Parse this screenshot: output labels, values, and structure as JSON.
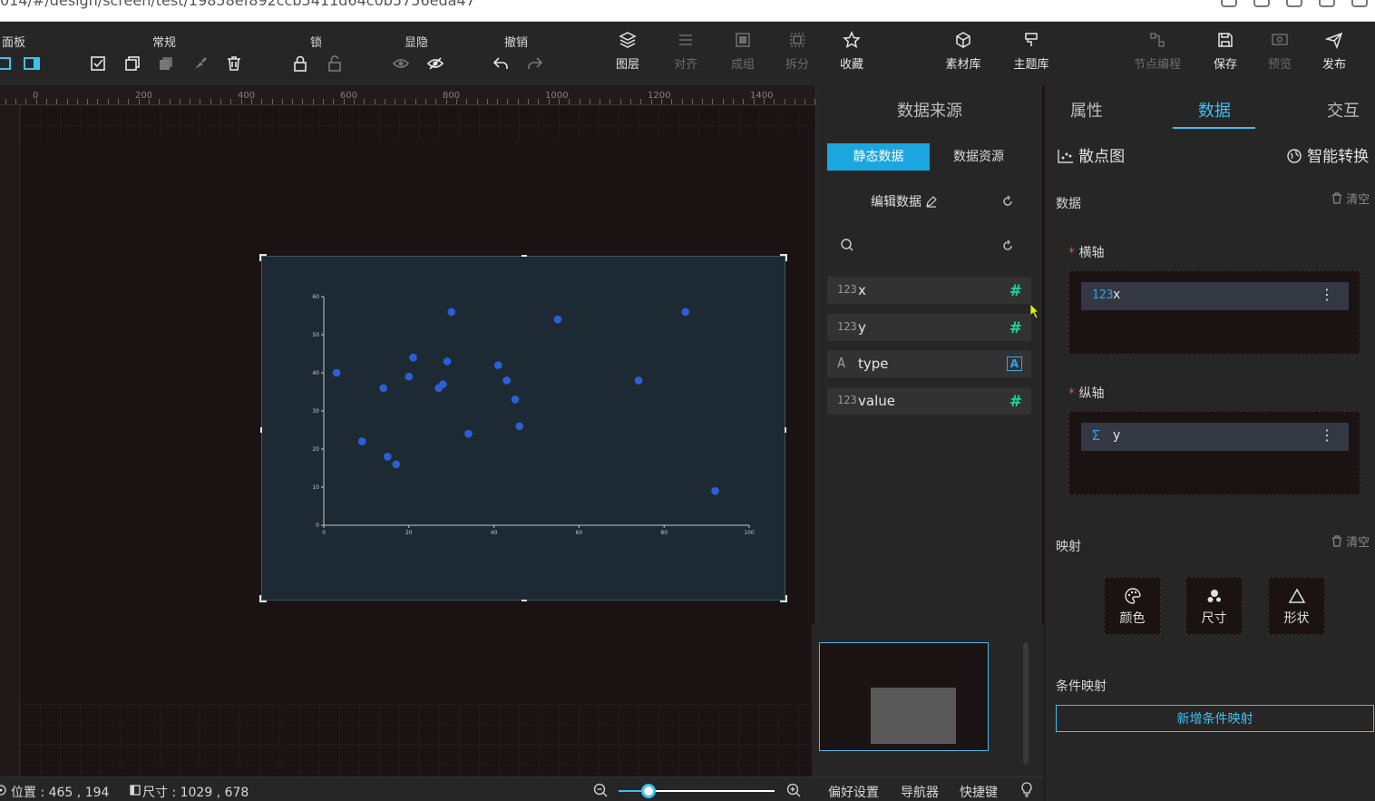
{
  "browser": {
    "url": "014/#/design/screen/test/19858ef892ccb5411d64c0b5756eda47"
  },
  "toolbar": {
    "groups": {
      "panel": "面板",
      "common": "常规",
      "lock": "锁",
      "visibility": "显隐",
      "undo": "撤销"
    },
    "buttons": {
      "layers": "图层",
      "align": "对齐",
      "group": "成组",
      "ungroup": "拆分",
      "favorite": "收藏",
      "assets": "素材库",
      "themes": "主题库",
      "node_program": "节点编程",
      "save": "保存",
      "preview": "预览",
      "publish": "发布"
    }
  },
  "ruler": {
    "labels": [
      "0",
      "200",
      "400",
      "600",
      "800",
      "1000",
      "1200",
      "1400"
    ]
  },
  "datasource": {
    "title": "数据来源",
    "tab_static": "静态数据",
    "tab_resource": "数据资源",
    "edit_label": "编辑数据",
    "fields": [
      {
        "type": "123",
        "name": "x",
        "badge": "#"
      },
      {
        "type": "123",
        "name": "y",
        "badge": "#"
      },
      {
        "type": "A",
        "name": "type",
        "badge": "A"
      },
      {
        "type": "123",
        "name": "value",
        "badge": "#"
      }
    ]
  },
  "props": {
    "tab_attr": "属性",
    "tab_data": "数据",
    "tab_interact": "交互",
    "chart_type": "散点图",
    "smart_convert": "智能转换",
    "data_label": "数据",
    "clear_label": "清空",
    "x_axis_label": "横轴",
    "x_axis_chip": {
      "type": "123",
      "name": "x"
    },
    "y_axis_label": "纵轴",
    "y_axis_chip": {
      "type": "Σ",
      "name": "y"
    },
    "mapping_label": "映射",
    "map_color": "颜色",
    "map_size": "尺寸",
    "map_shape": "形状",
    "cond_mapping_label": "条件映射",
    "add_cond_button": "新增条件映射"
  },
  "status": {
    "position": "位置 : 465 , 194",
    "size": "尺寸 : 1029 , 678",
    "zoom_fraction": 0.19,
    "prefs": "偏好设置",
    "navigator": "导航器",
    "shortcuts": "快捷键"
  },
  "colors": {
    "accent": "#3cc0f2",
    "point": "#2b5fd9",
    "field_badge": "#19d6a0"
  },
  "chart_data": {
    "type": "scatter",
    "xlim": [
      0,
      100
    ],
    "ylim": [
      0,
      60
    ],
    "x_ticks": [
      "0",
      "20",
      "40",
      "60",
      "80",
      "100"
    ],
    "y_ticks": [
      "0",
      "10",
      "20",
      "30",
      "40",
      "50",
      "60"
    ],
    "points": [
      {
        "x": 3,
        "y": 40
      },
      {
        "x": 9,
        "y": 22
      },
      {
        "x": 14,
        "y": 36
      },
      {
        "x": 15,
        "y": 18
      },
      {
        "x": 17,
        "y": 16
      },
      {
        "x": 20,
        "y": 39
      },
      {
        "x": 21,
        "y": 44
      },
      {
        "x": 27,
        "y": 36
      },
      {
        "x": 28,
        "y": 37
      },
      {
        "x": 29,
        "y": 43
      },
      {
        "x": 30,
        "y": 56
      },
      {
        "x": 34,
        "y": 24
      },
      {
        "x": 41,
        "y": 42
      },
      {
        "x": 43,
        "y": 38
      },
      {
        "x": 45,
        "y": 33
      },
      {
        "x": 46,
        "y": 26
      },
      {
        "x": 55,
        "y": 54
      },
      {
        "x": 74,
        "y": 38
      },
      {
        "x": 85,
        "y": 56
      },
      {
        "x": 92,
        "y": 9
      }
    ]
  }
}
